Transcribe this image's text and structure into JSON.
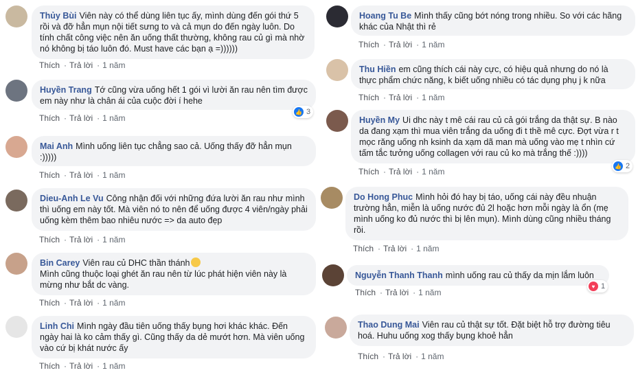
{
  "actions": {
    "like": "Thích",
    "reply": "Trả lời"
  },
  "left": [
    {
      "name": "Thủy Bùi",
      "text": "Viên này có thể dùng liên tục ấy, mình dùng đến gói thứ 5 rồi và đỡ hẳn mụn nội tiết sưng to và cả mụn do đến ngày luôn. Do tính chất công việc nên ăn uống thất thường, không rau củ gì mà nhờ nó không bị táo luôn đó. Must have các bạn ạ =))))))",
      "time": "1 năm",
      "avatar_color": "#c9b9a0"
    },
    {
      "name": "Huyền Trang",
      "text": "Tớ cũng vừa uống hết 1 gói vì lười ăn rau nên tìm được em này như là chân ái của cuộc đời í hehe",
      "time": "1 năm",
      "avatar_color": "#6d7480",
      "reaction": {
        "type": "like",
        "count": "3"
      }
    },
    {
      "name": "Mai Anh",
      "text": "Mình uống liên tục chẳng sao cả. Uống thấy đỡ hẳn mụn :)))))",
      "time": "1 năm",
      "avatar_color": "#d8a891"
    },
    {
      "name": "Dieu-Anh Le Vu",
      "text": "Công nhận đối với những đứa lười ăn rau như mình thì uống em này tốt. Mà viên nó to nên để uống được 4 viên/ngày phải uống kèm thêm bao nhiêu nước => da auto đẹp",
      "time": "1 năm",
      "avatar_color": "#7a6a5e"
    },
    {
      "name": "Bin Carey",
      "text": "Viên rau củ DHC thần thánh",
      "text2": "Mình cũng thuộc loại ghét ăn rau nên từ lúc phát hiện viên này là mừng như bắt dc vàng.",
      "time": "1 năm",
      "avatar_color": "#c7a18a",
      "emoji": "laughing-emoji"
    },
    {
      "name": "Linh Chi",
      "text": "Mình ngày đầu tiên uống thấy bụng hơi khác khác. Đến ngày hai là ko cảm thấy gì. Cũng thấy da dẻ mướt hơn. Mà viên uống vào cứ bị khát nước ấy",
      "time": "1 năm",
      "avatar_color": "#e6e6e6"
    }
  ],
  "right": [
    {
      "name": "Hoang Tu Be",
      "text": "Mình thấy cũng bớt nóng trong nhiều. So với các hãng khác của Nhật thì rẻ",
      "time": "1 năm",
      "avatar_color": "#2b2b33"
    },
    {
      "name": "Thu Hiền",
      "text": "em cũng thích cái này cực, có hiệu quả nhưng do nó là thực phẩm chức năng, k biết uống nhiều có tác dụng phụ j k nữa",
      "time": "1 năm",
      "avatar_color": "#d9c2a8"
    },
    {
      "name": "Huyền My",
      "text": "Ui dhc này t mê cái rau củ cả gói trắng da thật sự. B nào da đang xạm thì mua viên trắng da uống đi t thề mê cực. Đợt vừa r t mọc răng uống nh ksinh da xạm dã man mà uống vào mẹ t nhìn cứ tấm tắc tưởng uống collagen với rau củ ko mà trắng thế :))))",
      "time": "1 năm",
      "avatar_color": "#7b5a4d",
      "reaction": {
        "type": "like",
        "count": "2"
      }
    },
    {
      "name": "Do Hong Phuc",
      "text": "Mình hỏi đó hay bị táo, uống cái này đều nhuận trường hẳn, miễn là uống nước đủ 2l hoặc hơn mỗi ngày là ổn (mẹ mình uống ko đủ nước thì bị lên mụn). Mình dùng cũng nhiều tháng rồi.",
      "time": "1 năm",
      "avatar_color": "#a78b63"
    },
    {
      "name": "Nguyễn Thanh Thanh",
      "text": "mình uống rau củ thấy da mịn lắm luôn",
      "time": "1 năm",
      "avatar_color": "#5b4336",
      "reaction": {
        "type": "love",
        "count": "1"
      }
    },
    {
      "name": "Thao Dung Mai",
      "text": "Viên rau củ thật sự tốt. Đặt biệt hỗ trợ đường tiêu hoá. Huhu uống xog thấy bụng khoẻ hẳn",
      "time": "1 năm",
      "avatar_color": "#c9a99b"
    }
  ]
}
